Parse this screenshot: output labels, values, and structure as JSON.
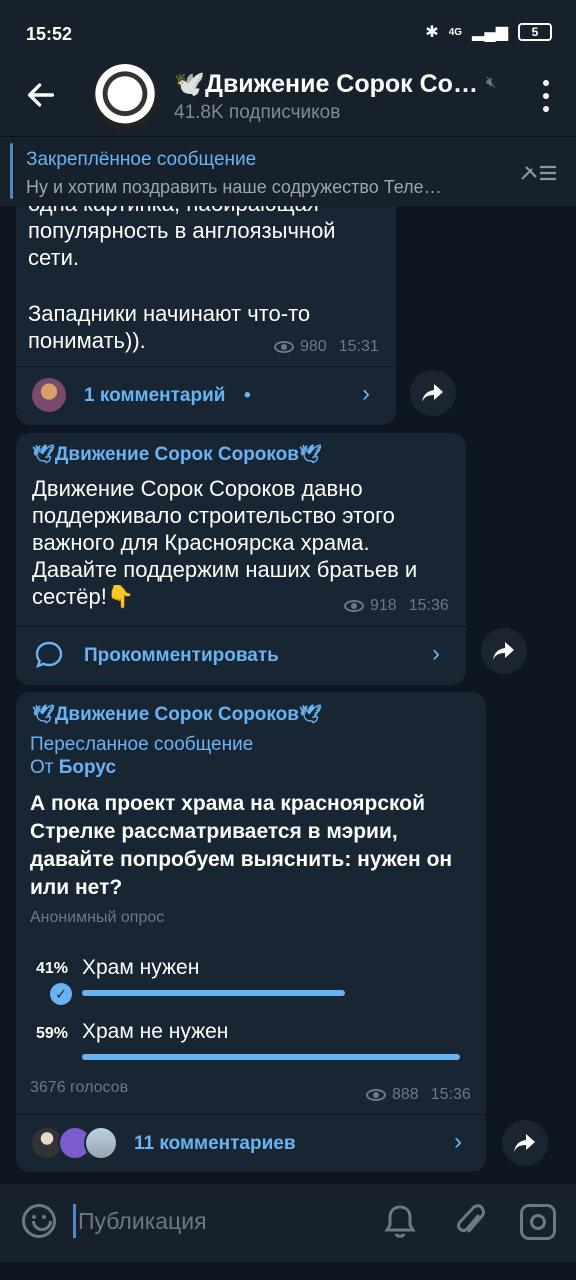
{
  "status": {
    "time": "15:52",
    "network": "4G",
    "battery": "5"
  },
  "channel": {
    "title": "🕊️Движение Сорок Со…",
    "subscribers": "41.8K подписчиков"
  },
  "pinned": {
    "title": "Закреплённое сообщение",
    "preview": "Ну и хотим поздравить наше содружество Теле…"
  },
  "msg1": {
    "text_top": "одна картинка, набирающая",
    "text": "популярность в англоязычной сети.",
    "text2": "Западники начинают что-то понимать)).",
    "views": "980",
    "time": "15:31",
    "comments": "1 комментарий"
  },
  "msg2": {
    "sender": "Движение Сорок Сороков",
    "text": "Движение Сорок Сороков давно поддерживало строительство этого важного для Красноярска храма. Давайте поддержим наших братьев и сестёр!👇",
    "views": "918",
    "time": "15:36",
    "comment_cta": "Прокомментировать"
  },
  "msg3": {
    "sender": "Движение Сорок Сороков",
    "forwarded_label": "Пересланное сообщение",
    "from_prefix": "От",
    "from_name": "Борус",
    "question": "А пока проект храма на красноярской Стрелке рассматривается в мэрии, давайте попробуем выяснить: нужен он или нет?",
    "poll_type": "Анонимный опрос",
    "options": [
      {
        "pct": "41%",
        "label": "Храм нужен",
        "fraction": 0.41,
        "chosen": true
      },
      {
        "pct": "59%",
        "label": "Храм не нужен",
        "fraction": 0.59,
        "chosen": false
      }
    ],
    "votes": "3676 голосов",
    "views": "888",
    "time": "15:36",
    "comments": "11 комментариев"
  },
  "input": {
    "placeholder": "Публикация"
  },
  "colors": {
    "bg": "#0e1621",
    "bubble": "#182533",
    "accent": "#6ab3f3",
    "muted": "#6c7883"
  }
}
